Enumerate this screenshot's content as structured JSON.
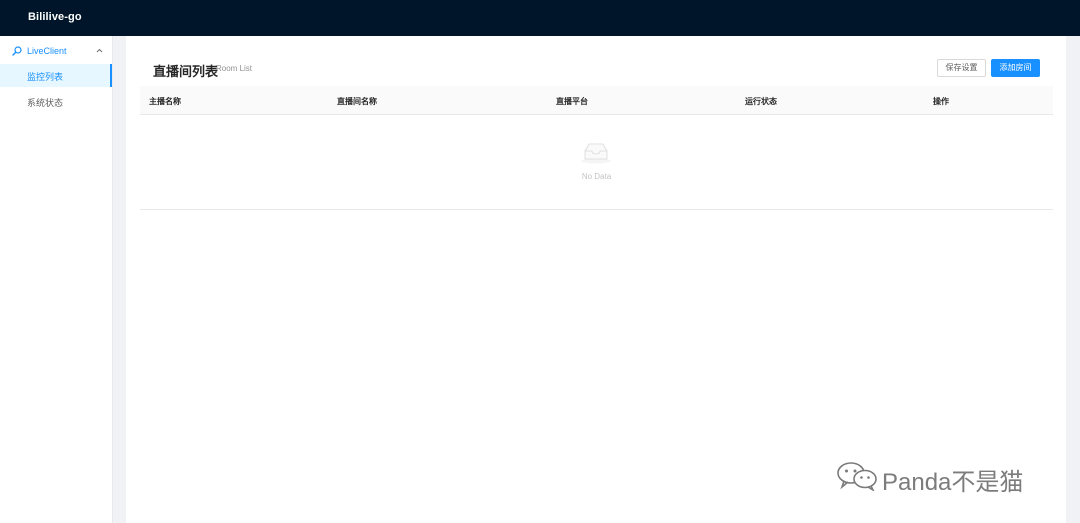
{
  "header": {
    "app_title": "Bililive-go"
  },
  "sidebar": {
    "group": {
      "label": "LiveClient",
      "icon": "live-icon",
      "expanded": true
    },
    "items": [
      {
        "label": "监控列表",
        "active": true
      },
      {
        "label": "系统状态",
        "active": false
      }
    ]
  },
  "page": {
    "title": "直播间列表",
    "subtitle": "Room List",
    "buttons": {
      "save_label": "保存设置",
      "add_label": "添加房间"
    }
  },
  "table": {
    "columns": [
      "主播名称",
      "直播间名称",
      "直播平台",
      "运行状态",
      "操作"
    ],
    "rows": [],
    "empty_text": "No Data",
    "empty_icon": "empty-inbox-icon"
  },
  "watermark": {
    "text": "Panda不是猫",
    "icon": "wechat-icon"
  },
  "colors": {
    "header_bg": "#001529",
    "primary": "#1890ff",
    "active_bg": "#e6f7ff",
    "layout_bg": "#f0f2f5"
  }
}
